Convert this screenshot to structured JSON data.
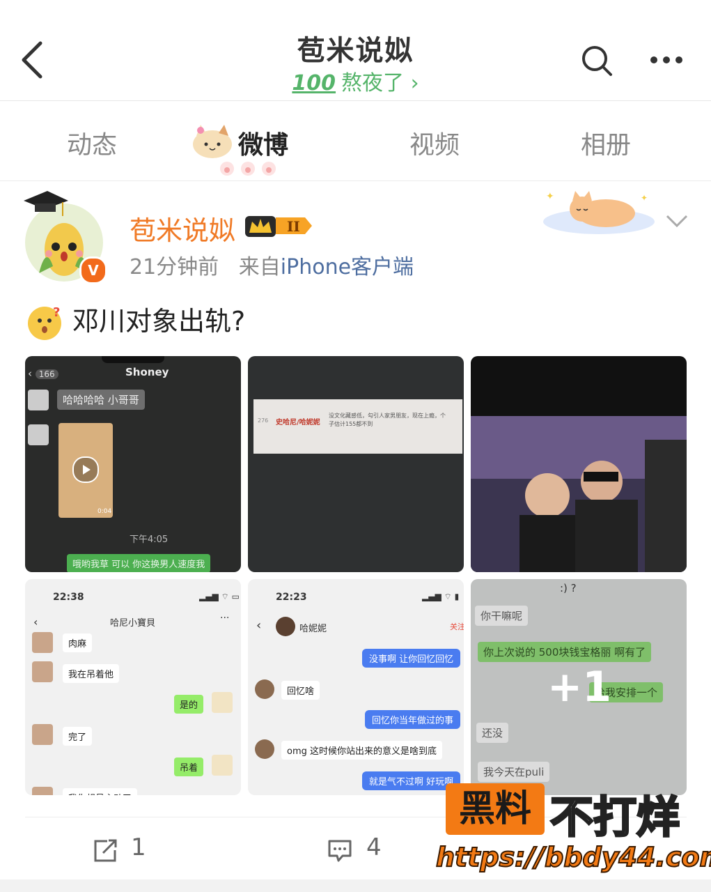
{
  "header": {
    "title": "苞米说姒",
    "subtitle_badge": "100",
    "subtitle": "熬夜了",
    "subtitle_arrow": "›",
    "accent_color": "#55b46a"
  },
  "tabs": [
    {
      "label": "动态",
      "active": false
    },
    {
      "label": "微博",
      "active": true
    },
    {
      "label": "视频",
      "active": false
    },
    {
      "label": "相册",
      "active": false
    }
  ],
  "post": {
    "author": "苞米说姒",
    "author_color": "#f07a26",
    "verified_badge": "V",
    "time": "21分钟前",
    "source": "来自",
    "client": "iPhone客户端",
    "text": "邓川对象出轨?",
    "images": {
      "img1": {
        "back": "166",
        "name": "Shoney",
        "msg1": "哈哈哈哈 小哥哥",
        "duration": "0:04",
        "time": "下午4:05",
        "msg2": "哦哟我草 可以 你这换男人速度我"
      },
      "img2": {
        "row_no": "276",
        "row_name": "史哈尼/哈妮妮",
        "row_desc": "没文化藏感低，勾引人家男朋友，现在上瘾，个子估计155都不到"
      },
      "img4": {
        "time": "22:38",
        "title": "哈尼小寶貝",
        "m1": "肉麻",
        "m2": "我在吊着他",
        "m3": "是的",
        "m4": "完了",
        "m5": "吊着",
        "m6": "我你想見主动了"
      },
      "img5": {
        "time": "22:23",
        "name": "哈妮妮",
        "follow": "关注",
        "m1": "没事啊 让你回忆回忆",
        "m2": "回忆啥",
        "m3": "回忆你当年做过的事",
        "m4": "omg 这时候你站出来的意义是啥到底",
        "m5": "就是气不过啊 好玩啊"
      },
      "img6": {
        "top": ":) ?",
        "m1": "你干嘛呢",
        "m2": "你上次说的 500块钱宝格丽 啊有了",
        "m3": "给我安排一个",
        "m4": "还没",
        "m5": "我今天在puli",
        "more": "+1"
      }
    }
  },
  "actions": {
    "repost_count": "1",
    "comment_count": "4"
  },
  "watermark": {
    "box": "黑料",
    "right": "不打烊",
    "url": "https://bbdy44.com"
  }
}
